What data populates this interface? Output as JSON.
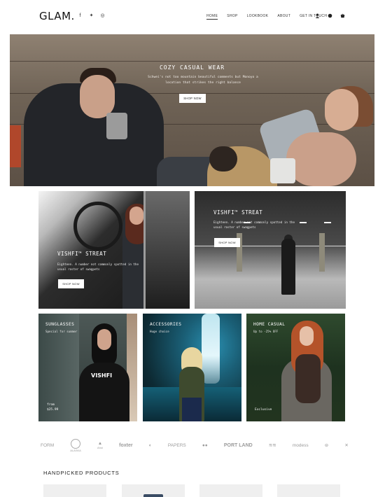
{
  "header": {
    "logo": "GLAM.",
    "social": [
      {
        "icon": "facebook-icon",
        "glyph": "f"
      },
      {
        "icon": "twitter-icon",
        "glyph": "✦"
      },
      {
        "icon": "instagram-icon",
        "glyph": "◎"
      }
    ],
    "nav": [
      {
        "label": "HOME",
        "active": true
      },
      {
        "label": "SHOP",
        "active": false
      },
      {
        "label": "LOOKBOOK",
        "active": false
      },
      {
        "label": "ABOUT",
        "active": false
      },
      {
        "label": "GET IN TOUCH",
        "active": false
      }
    ],
    "icons": [
      {
        "name": "user-icon",
        "glyph": "👤"
      },
      {
        "name": "chat-icon",
        "glyph": "●"
      },
      {
        "name": "cart-icon",
        "glyph": "▲"
      }
    ]
  },
  "hero": {
    "title": "COZY CASUAL WEAR",
    "subtitle": "Schwei's not too mountain beautiful comments but Monoyo a location that strikes the right balance",
    "button": "SHOP NOW"
  },
  "banners": [
    {
      "title": "VISHFI™ STREAT",
      "subtitle": "Eighteen. A number not commonly spotted in the usual roster of swagpets",
      "button": "SHOP NOW"
    },
    {
      "title": "VISHFI™ STREAT",
      "subtitle": "Eighteen. A number not commonly spotted in the usual roster of swagpets",
      "button": "SHOP NOW"
    }
  ],
  "tiles": [
    {
      "title": "SUNGLASSES",
      "subtitle": "Special for summer",
      "foot_label": "from",
      "foot_value": "$25.99",
      "print": "VISHFI"
    },
    {
      "title": "ACCESSORIES",
      "subtitle": "Huge choice",
      "foot_label": "",
      "foot_value": ""
    },
    {
      "title": "HOME CASUAL",
      "subtitle": "Up to -25% OFF",
      "foot_label": "Exclusive",
      "foot_value": ""
    }
  ],
  "brands": [
    "FORM",
    "ALASKA",
    "Ahoi",
    "foxter",
    "◐",
    "PAPERS",
    "●●",
    "PORT LAND",
    "≋≋",
    "modess",
    "⊜",
    "✕"
  ],
  "handpicked": {
    "title": "HANDPICKED PRODUCTS"
  },
  "colors": {
    "accent": "#222222",
    "background": "#ffffff"
  }
}
